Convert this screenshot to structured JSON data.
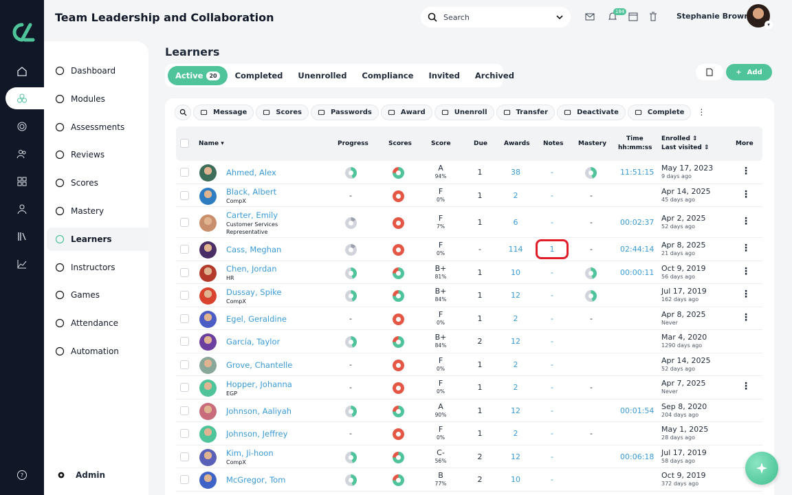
{
  "app": {
    "title": "Team Leadership and Collaboration"
  },
  "search": {
    "placeholder": "Search"
  },
  "notifications": {
    "count": "184"
  },
  "user": {
    "name": "Stephanie Brown"
  },
  "sidebar": {
    "items": [
      {
        "label": "Dashboard",
        "icon": "info-icon"
      },
      {
        "label": "Modules",
        "icon": "modules-icon"
      },
      {
        "label": "Assessments",
        "icon": "assessment-icon"
      },
      {
        "label": "Reviews",
        "icon": "star-icon"
      },
      {
        "label": "Scores",
        "icon": "scores-icon"
      },
      {
        "label": "Mastery",
        "icon": "bar-chart-icon"
      },
      {
        "label": "Learners",
        "icon": "user-icon",
        "active": true
      },
      {
        "label": "Instructors",
        "icon": "instructor-icon"
      },
      {
        "label": "Games",
        "icon": "trophy-icon"
      },
      {
        "label": "Attendance",
        "icon": "attendance-icon"
      },
      {
        "label": "Automation",
        "icon": "automation-icon"
      }
    ],
    "admin": "Admin"
  },
  "page": {
    "title": "Learners",
    "add_label": "Add"
  },
  "tabs": [
    {
      "label": "Active",
      "count": "20",
      "active": true
    },
    {
      "label": "Completed"
    },
    {
      "label": "Unenrolled"
    },
    {
      "label": "Compliance"
    },
    {
      "label": "Invited"
    },
    {
      "label": "Archived"
    }
  ],
  "toolbar": [
    "Message",
    "Scores",
    "Passwords",
    "Award",
    "Unenroll",
    "Transfer",
    "Deactivate",
    "Complete"
  ],
  "columns": {
    "name": "Name",
    "progress": "Progress",
    "scores": "Scores",
    "score": "Score",
    "due": "Due",
    "awards": "Awards",
    "notes": "Notes",
    "mastery": "Mastery",
    "time1": "Time",
    "time2": "hh:mm:ss",
    "enrolled": "Enrolled",
    "last_visited": "Last visited",
    "more": "More"
  },
  "colors": {
    "accent": "#4fc39a",
    "link": "#3a9bd5",
    "highlight": "#e11d2a"
  },
  "rows": [
    {
      "name": "Ahmed, Alex",
      "sub": "",
      "progress": "pie",
      "grade": "A",
      "pct": "94%",
      "due": "1",
      "awards": "38",
      "notes": "-",
      "mastery": "pie",
      "time": "11:51:15",
      "enrolled": "May 17, 2023",
      "ago": "9 days ago",
      "more": true
    },
    {
      "name": "Black, Albert",
      "sub": "CompX",
      "progress": "-",
      "grade": "F",
      "pct": "0%",
      "due": "1",
      "awards": "2",
      "notes": "-",
      "mastery": "-",
      "time": "",
      "enrolled": "Apr 14, 2025",
      "ago": "45 days ago",
      "more": true
    },
    {
      "name": "Carter, Emily",
      "sub": "Customer Services Representative",
      "progress": "pie",
      "grade": "F",
      "pct": "7%",
      "due": "1",
      "awards": "6",
      "notes": "-",
      "mastery": "-",
      "time": "00:02:37",
      "enrolled": "Apr 2, 2025",
      "ago": "52 days ago",
      "more": true
    },
    {
      "name": "Cass, Meghan",
      "sub": "",
      "progress": "pie",
      "grade": "F",
      "pct": "0%",
      "due": "-",
      "awards": "114",
      "notes": "1",
      "mastery": "-",
      "time": "02:44:14",
      "enrolled": "Apr 8, 2025",
      "ago": "21 days ago",
      "more": true
    },
    {
      "name": "Chen, Jordan",
      "sub": "HR",
      "progress": "pie",
      "grade": "B+",
      "pct": "81%",
      "due": "1",
      "awards": "10",
      "notes": "-",
      "mastery": "pie",
      "time": "00:00:11",
      "enrolled": "Oct 9, 2019",
      "ago": "56 days ago",
      "more": true
    },
    {
      "name": "Dussay, Spike",
      "sub": "CompX",
      "progress": "pie",
      "grade": "B+",
      "pct": "84%",
      "due": "1",
      "awards": "12",
      "notes": "-",
      "mastery": "pie",
      "time": "",
      "enrolled": "Jul 17, 2019",
      "ago": "162 days ago",
      "more": true
    },
    {
      "name": "Egel, Geraldine",
      "sub": "",
      "progress": "-",
      "grade": "F",
      "pct": "0%",
      "due": "1",
      "awards": "2",
      "notes": "-",
      "mastery": "-",
      "time": "",
      "enrolled": "Apr 8, 2025",
      "ago": "Never",
      "more": true
    },
    {
      "name": "García, Taylor",
      "sub": "",
      "progress": "pie",
      "grade": "B+",
      "pct": "84%",
      "due": "2",
      "awards": "12",
      "notes": "-",
      "mastery": "",
      "time": "",
      "enrolled": "Mar 4, 2020",
      "ago": "1290 days ago",
      "more": false
    },
    {
      "name": "Grove, Chantelle",
      "sub": "",
      "progress": "-",
      "grade": "F",
      "pct": "0%",
      "due": "1",
      "awards": "2",
      "notes": "-",
      "mastery": "",
      "time": "",
      "enrolled": "Apr 14, 2025",
      "ago": "52 days ago",
      "more": false
    },
    {
      "name": "Hopper, Johanna",
      "sub": "EGP",
      "progress": "-",
      "grade": "F",
      "pct": "0%",
      "due": "1",
      "awards": "2",
      "notes": "-",
      "mastery": "-",
      "time": "",
      "enrolled": "Apr 7, 2025",
      "ago": "Never",
      "more": true
    },
    {
      "name": "Johnson, Aaliyah",
      "sub": "",
      "progress": "pie",
      "grade": "A",
      "pct": "90%",
      "due": "1",
      "awards": "12",
      "notes": "-",
      "mastery": "",
      "time": "00:01:54",
      "enrolled": "Sep 8, 2020",
      "ago": "204 days ago",
      "more": false
    },
    {
      "name": "Johnson, Jeffrey",
      "sub": "",
      "progress": "-",
      "grade": "F",
      "pct": "0%",
      "due": "1",
      "awards": "2",
      "notes": "-",
      "mastery": "-",
      "time": "",
      "enrolled": "May 1, 2025",
      "ago": "28 days ago",
      "more": false
    },
    {
      "name": "Kim, Ji-hoon",
      "sub": "CompX",
      "progress": "pie",
      "grade": "C-",
      "pct": "56%",
      "due": "2",
      "awards": "12",
      "notes": "-",
      "mastery": "",
      "time": "00:06:18",
      "enrolled": "Jul 17, 2019",
      "ago": "58 days ago",
      "more": false
    },
    {
      "name": "McGregor, Tom",
      "sub": "",
      "progress": "pie",
      "grade": "B",
      "pct": "77%",
      "due": "2",
      "awards": "10",
      "notes": "-",
      "mastery": "",
      "time": "",
      "enrolled": "Oct 9, 2019",
      "ago": "372 days ago",
      "more": false
    }
  ]
}
